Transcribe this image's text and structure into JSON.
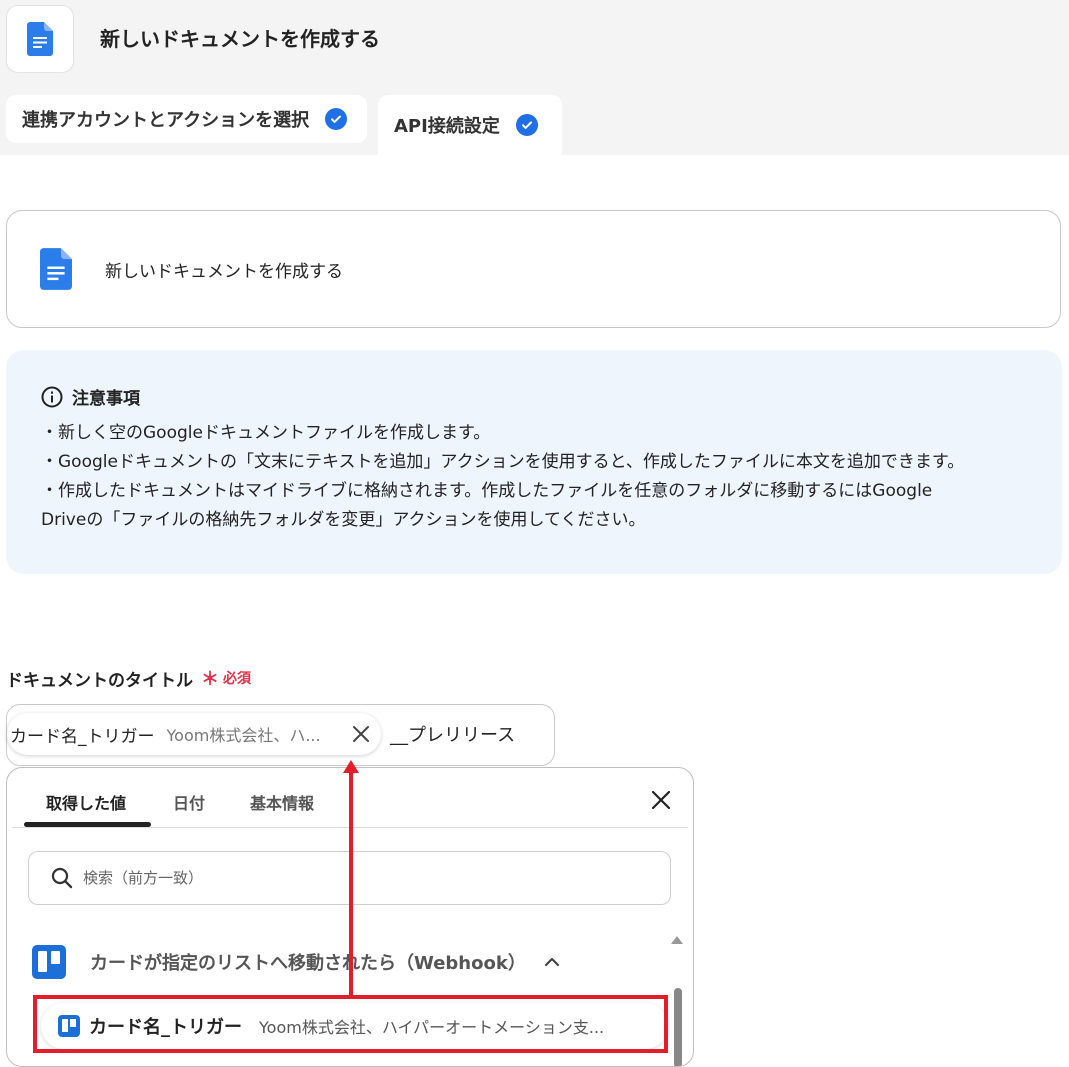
{
  "header": {
    "app_icon": "google-docs-icon",
    "title": "新しいドキュメントを作成する"
  },
  "steps": [
    {
      "label": "連携アカウントとアクションを選択",
      "status": "done"
    },
    {
      "label": "API接続設定",
      "status": "done"
    }
  ],
  "action": {
    "icon": "google-docs-icon",
    "label": "新しいドキュメントを作成する"
  },
  "notice": {
    "heading": "注意事項",
    "lines": [
      "・新しく空のGoogleドキュメントファイルを作成します。",
      "・Googleドキュメントの「文末にテキストを追加」アクションを使用すると、作成したファイルに本文を追加できます。",
      "・作成したドキュメントはマイドライブに格納されます。作成したファイルを任意のフォルダに移動するにはGoogle",
      "Driveの「ファイルの格納先フォルダを変更」アクションを使用してください。"
    ]
  },
  "title_field": {
    "label": "ドキュメントのタイトル",
    "required_mark": "＊",
    "required_text": "必須",
    "chip": {
      "name": "カード名_トリガー",
      "value": "Yoom株式会社、ハ..."
    },
    "suffix": "__プレリリース"
  },
  "picker": {
    "tabs": [
      "取得した値",
      "日付",
      "基本情報"
    ],
    "active_tab": "取得した値",
    "search_placeholder": "検索（前方一致）",
    "group": {
      "label": "カードが指定のリストへ移動されたら（Webhook）",
      "expanded": true
    },
    "item": {
      "name": "カード名_トリガー",
      "value": "Yoom株式会社、ハイパーオートメーション支..."
    }
  },
  "colors": {
    "accent": "#1f6fe5",
    "highlight": "#e11e2a",
    "notice_bg": "#eef5fc",
    "required": "#e0314b",
    "trello": "#1c6fd8"
  }
}
